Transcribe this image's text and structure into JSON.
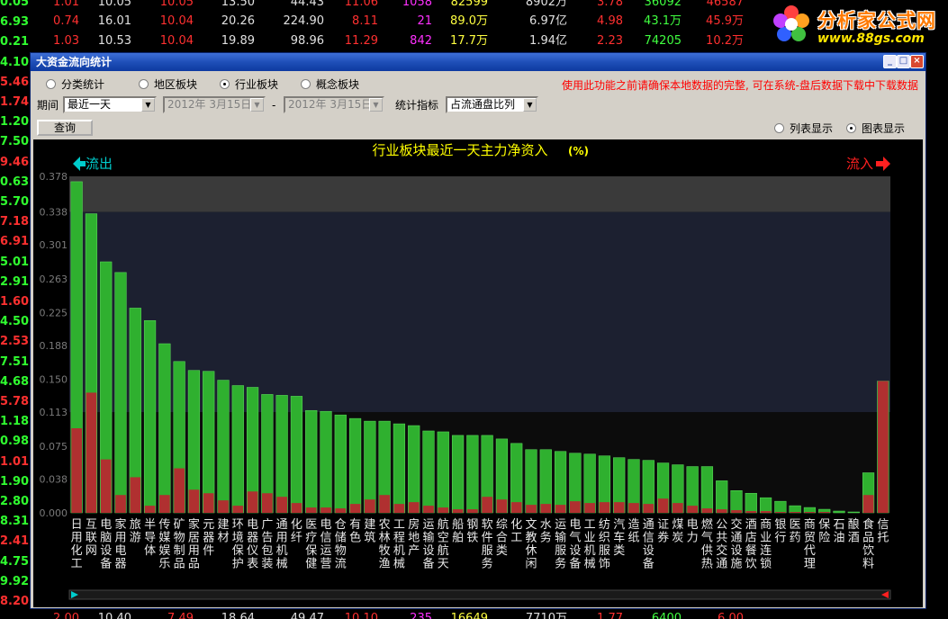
{
  "background_rows": [
    {
      "cells": [
        "1.01",
        "10.05",
        "10.05",
        "13.50",
        "44.43",
        "11.06",
        "1058",
        "82599",
        "8902万",
        "3.78",
        "36092",
        "46587"
      ]
    },
    {
      "cells": [
        "0.74",
        "16.01",
        "10.04",
        "20.26",
        "224.90",
        "8.11",
        "21",
        "89.0万",
        "6.97亿",
        "4.98",
        "43.1万",
        "45.9万"
      ]
    },
    {
      "cells": [
        "1.03",
        "10.53",
        "10.04",
        "19.89",
        "98.96",
        "11.29",
        "842",
        "17.7万",
        "1.94亿",
        "2.23",
        "74205",
        "10.2万"
      ]
    },
    {
      "cells": [
        "2.00",
        "10.40",
        "7.49",
        "18.64",
        "49.47",
        "10.10",
        "235",
        "16649",
        "7710万",
        "1.77",
        "6400",
        "6.00"
      ]
    }
  ],
  "background_left_col": [
    "0.05",
    "6.93",
    "0.21",
    "4.10",
    "5.46",
    "1.74",
    "1.20",
    "7.50",
    "9.46",
    "0.63",
    "5.70",
    "7.18",
    "6.91",
    "5.01",
    "2.91",
    "1.60",
    "4.50",
    "2.53",
    "7.51",
    "4.68",
    "5.78",
    "1.18",
    "0.98",
    "1.01",
    "1.90",
    "2.80",
    "8.31",
    "2.41",
    "4.75",
    "9.92",
    "8.20"
  ],
  "logo": {
    "name": "分析家公式网",
    "url": "www.88gs.com"
  },
  "window": {
    "title": "大资金流向统计",
    "minimize": "_",
    "maximize": "□",
    "close": "×"
  },
  "filter": {
    "radios": [
      {
        "label": "分类统计",
        "checked": false
      },
      {
        "label": "地区板块",
        "checked": false
      },
      {
        "label": "行业板块",
        "checked": true
      },
      {
        "label": "概念板块",
        "checked": false
      }
    ],
    "notice": "使用此功能之前请确保本地数据的完整, 可在系统-盘后数据下载中下载数据",
    "period_label": "期间",
    "period_value": "最近一天",
    "date_from": "2012年 3月15日",
    "date_sep": "-",
    "date_to": "2012年 3月15日",
    "indicator_label": "统计指标",
    "indicator_value": "占流通盘比列",
    "query_button": "查询",
    "view_list": "列表显示",
    "view_chart": "图表显示",
    "view_chart_selected": true
  },
  "chart_data": {
    "type": "bar",
    "title": "行业板块最近一天主力净资入",
    "title_unit": "(%)",
    "left_label": "流出",
    "right_label": "流入",
    "ylim": [
      0,
      0.378
    ],
    "yticks": [
      "0.378",
      "0.338",
      "0.301",
      "0.263",
      "0.225",
      "0.188",
      "0.150",
      "0.113",
      "0.075",
      "0.038",
      "0.000"
    ],
    "categories": [
      "日用化工",
      "互联网",
      "电脑设备",
      "家用电器",
      "旅游",
      "半导体",
      "传媒娱乐",
      "矿物制品",
      "家居用品",
      "元器件",
      "建材",
      "环境保护",
      "电器仪表",
      "广告包装",
      "通用机械",
      "化纤",
      "医疗保健",
      "电信运营",
      "仓储物流",
      "有色",
      "建筑",
      "农林牧渔",
      "工程机械",
      "房地产",
      "运输设备",
      "航空航天",
      "船舶",
      "钢铁",
      "软件服务",
      "综合类",
      "化工",
      "文教休闲",
      "水务",
      "运输服务",
      "电气设备",
      "工业机械",
      "纺织服饰",
      "汽车类",
      "造纸",
      "通信设备",
      "证券",
      "煤炭",
      "电力",
      "燃气供热",
      "公共交通",
      "交通设施",
      "酒店餐饮",
      "商业连锁",
      "银行",
      "医药",
      "商贸代理",
      "保险",
      "石油",
      "酿酒",
      "食品饮料",
      "信托"
    ],
    "series": [
      {
        "values": [
          0.372,
          0.336,
          0.282,
          0.27,
          0.23,
          0.216,
          0.19,
          0.17,
          0.16,
          0.159,
          0.149,
          0.143,
          0.141,
          0.133,
          0.132,
          0.131,
          0.115,
          0.114,
          0.11,
          0.106,
          0.103,
          0.103,
          0.1,
          0.098,
          0.092,
          0.091,
          0.087,
          0.087,
          0.087,
          0.083,
          0.078,
          0.071,
          0.071,
          0.069,
          0.067,
          0.066,
          0.064,
          0.062,
          0.06,
          0.059,
          0.056,
          0.054,
          0.052,
          0.052,
          0.036,
          0.025,
          0.022,
          0.017,
          0.013,
          0.008,
          0.006,
          0.004,
          0.002,
          0.001,
          0.045,
          0.148
        ]
      },
      {
        "values": [
          0.095,
          0.135,
          0.06,
          0.02,
          0.04,
          0.008,
          0.02,
          0.05,
          0.026,
          0.022,
          0.014,
          0.008,
          0.024,
          0.022,
          0.018,
          0.011,
          0.006,
          0.006,
          0.005,
          0.01,
          0.015,
          0.02,
          0.01,
          0.012,
          0.008,
          0.006,
          0.004,
          0.004,
          0.018,
          0.015,
          0.012,
          0.009,
          0.01,
          0.009,
          0.013,
          0.011,
          0.012,
          0.012,
          0.011,
          0.01,
          0.016,
          0.011,
          0.008,
          0.005,
          0.004,
          0.003,
          0.002,
          0.002,
          0.001,
          0.001,
          0.001,
          0.001,
          0,
          0,
          0.02,
          0.148
        ]
      }
    ]
  },
  "colors": {
    "bar_green": "#2fb02f",
    "bar_red": "#b03030",
    "grid_text": "#7a7a7a",
    "title_text": "#ffff00",
    "arrow": "#00cccc",
    "arrow_right": "#ff2020"
  }
}
